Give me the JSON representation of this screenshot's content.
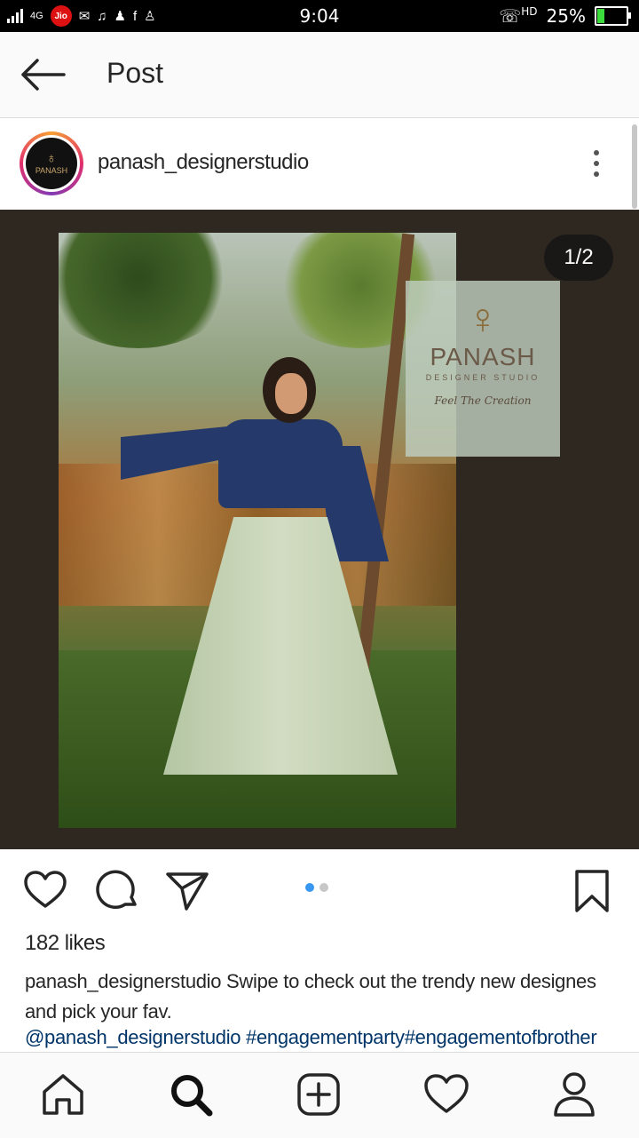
{
  "status_bar": {
    "network": "4G",
    "carrier": "Jio",
    "time": "9:04",
    "call_label": "HD",
    "battery": "25",
    "battery_unit": "%",
    "battery_level": 0.25
  },
  "app_bar": {
    "title": "Post"
  },
  "post": {
    "username": "panash_designerstudio",
    "avatar_text": "PANASH",
    "image_counter": "1/2",
    "brand_overlay": {
      "name": "PANASH",
      "subtitle": "DESIGNER STUDIO",
      "tagline": "Feel The Creation"
    },
    "carousel": {
      "count": 2,
      "active": 0
    },
    "likes": "182 likes",
    "caption_user": "panash_designerstudio",
    "caption_text": " Swipe to check out the trendy new designes and pick your fav.",
    "tags": [
      "@panash_designerstudio",
      " #engagementparty",
      "#engagementofbrother"
    ]
  },
  "colors": {
    "accent": "#3897f0",
    "link": "#003569",
    "media_bg": "#2e2821"
  },
  "icons": {
    "actions": [
      "heart-icon",
      "comment-icon",
      "share-icon",
      "bookmark-icon"
    ],
    "bottom_nav": [
      "home-icon",
      "search-icon",
      "add-icon",
      "activity-heart-icon",
      "profile-icon"
    ]
  }
}
